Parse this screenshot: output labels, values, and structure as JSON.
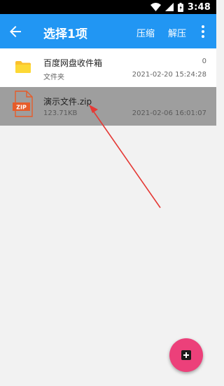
{
  "status_bar": {
    "time": "3:48"
  },
  "app_bar": {
    "title": "选择1项",
    "actions": {
      "compress": "压缩",
      "extract": "解压"
    }
  },
  "files": [
    {
      "name": "百度网盘收件箱",
      "type_label": "文件夹",
      "count": "0",
      "date": "2021-02-20 15:24:28",
      "icon": "folder-icon",
      "selected": false
    },
    {
      "name": "演示文件.zip",
      "size": "123.71KB",
      "date": "2021-02-06 16:01:07",
      "icon": "zip-file-icon",
      "icon_text": "ZIP",
      "selected": true
    }
  ],
  "colors": {
    "app_bar": "#2196f3",
    "fab": "#ec407a",
    "selected_row": "#9e9e9e",
    "folder": "#fbc02d",
    "zip": "#e65c2a",
    "arrow": "#e53935"
  },
  "fab": {
    "icon": "add-icon"
  }
}
